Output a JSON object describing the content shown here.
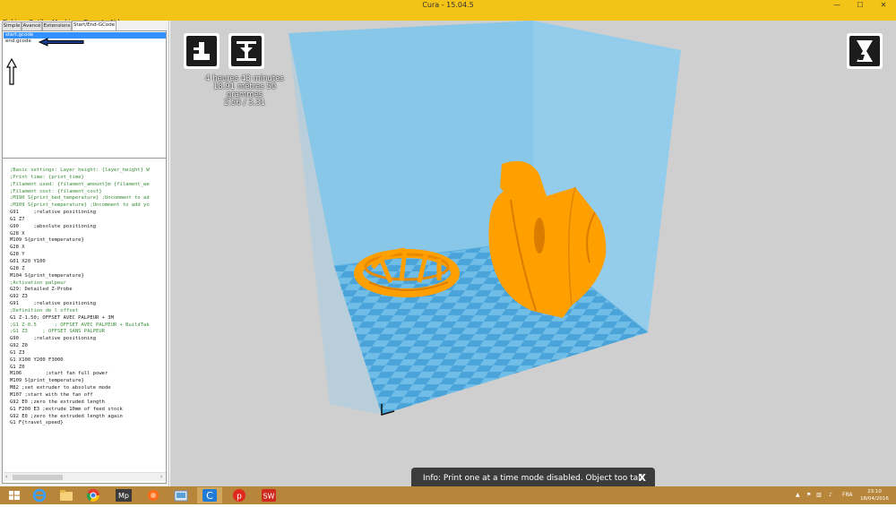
{
  "window": {
    "title": "Cura - 15.04.5",
    "minimize": "—",
    "maximize": "☐",
    "close": "✕"
  },
  "menu": [
    "Fichier",
    "Outils",
    "Machine",
    "Expert",
    "Aide"
  ],
  "tabs": [
    "Simple",
    "Avancé",
    "Extensions",
    "Start/End-GCode"
  ],
  "active_tab": "Start/End-GCode",
  "files": [
    "start.gcode",
    "end.gcode"
  ],
  "selected_file": "start.gcode",
  "gcode_lines": [
    ";Basic settings: Layer height: {layer_height} W",
    ";Print time: {print_time}",
    ";Filament used: {filament_amount}m {filament_we",
    ";Filament cost: {filament_cost}",
    ";M190 S{print_bed_temperature} ;Uncomment to ad",
    ";M109 S{print_temperature} ;Uncomment to add yo",
    "G91     ;relative positioning",
    "G1 Z7",
    "G90     ;absolute positioning",
    "G28 X",
    "M109 S{print_temperature}",
    "G28 X",
    "G28 Y",
    "G01 X20 Y100",
    "G28 Z",
    "M104 S{print_temperature}",
    ";Activation palpeur",
    "G29: Detailed Z-Probe",
    "G92 Z3",
    "G91     ;relative positioning",
    ";Definition de l offset",
    "G1 Z-1.50; OFFSET AVEC PALPEUR + 3M",
    ";G1 Z-0.5      ; OFFSET AVEC PALPEUR + BuildTak",
    ";G1 Z3     ; OFFSET SANS PALPEUR",
    "G90     ;relative positioning",
    "G92 Z0",
    "G1 Z3",
    "G1 X100 Y200 F3000",
    "G1 Z0",
    "M106        ;start fan full power",
    "M109 S{print_temperature}",
    "M82 ;set extruder to absolute mode",
    "M107 ;start with the fan off",
    "G92 E0 ;zero the extruded length",
    "G1 F200 E3 ;extrude 10mm of feed stock",
    "G92 E0 ;zero the extruded length again",
    "G1 F{travel_speed}"
  ],
  "print_info": {
    "time": "4 heures 43 minutes",
    "material": "18.91 mètres 50 grammes",
    "cost": "2.56 / 3.31"
  },
  "notification": {
    "text": "Info: Print one at a time mode disabled. Object too tall.",
    "close": "X"
  },
  "tray": {
    "lang": "FRA",
    "time": "23:10",
    "date": "18/04/2016"
  },
  "colors": {
    "titlebar": "#f3c318",
    "taskbar": "#b8863b",
    "build_volume": "#7ec6ea",
    "build_plate_dark": "#4aa4d9",
    "build_plate_light": "#70bde8",
    "model": "#ff9f00",
    "selection": "#3390ff"
  }
}
